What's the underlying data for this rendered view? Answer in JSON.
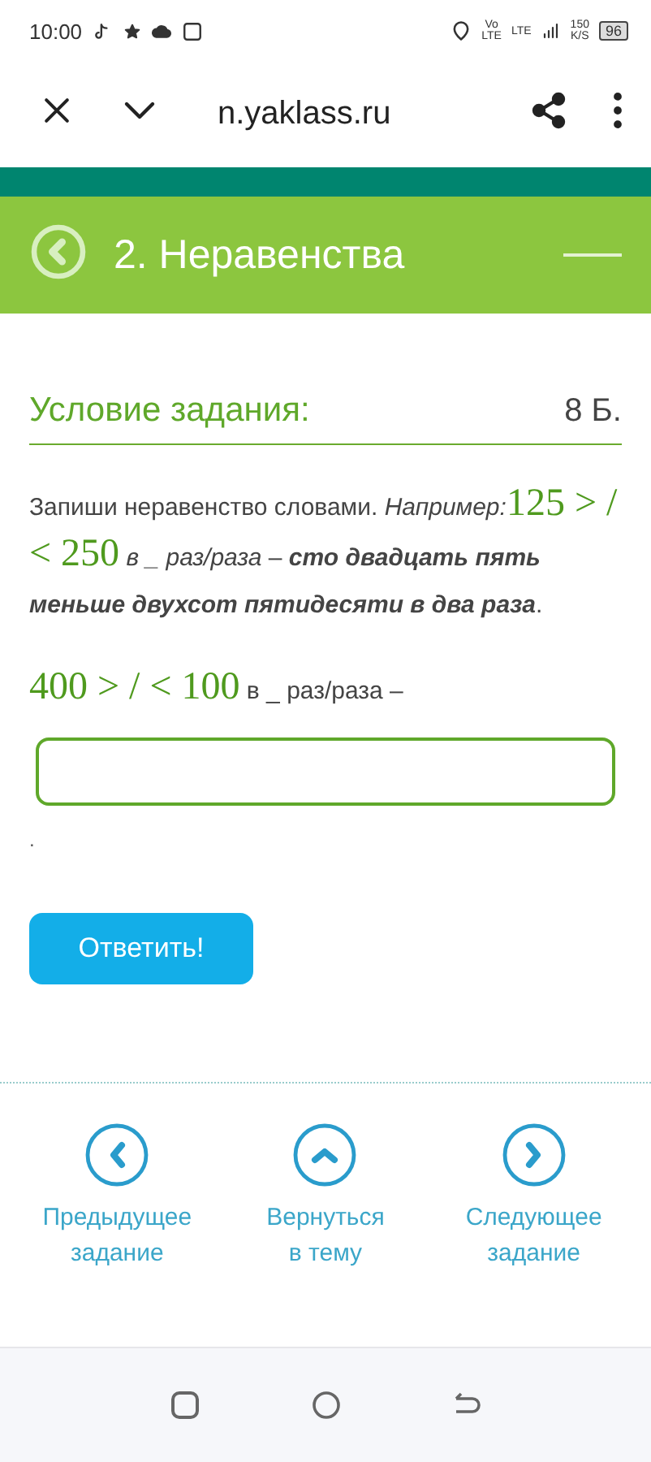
{
  "status_bar": {
    "time": "10:00",
    "volte_top": "Vo",
    "volte_bottom": "LTE",
    "network": "LTE",
    "speed": "150",
    "speed_unit": "K/S",
    "battery": "96"
  },
  "browser": {
    "url": "n.yaklass.ru"
  },
  "header": {
    "title": "2. Неравенства"
  },
  "task": {
    "heading": "Условие задания:",
    "points": "8 Б.",
    "instruction": [
      {
        "kind": "plain",
        "text": "Запиши неравенство словами. "
      },
      {
        "kind": "italic",
        "text": "Например:"
      },
      {
        "kind": "math",
        "text": "125 > / < 250"
      },
      {
        "kind": "italic",
        "text": " в _ раз/раза"
      },
      {
        "kind": "plain",
        "text": " – "
      },
      {
        "kind": "bold_italic",
        "text": "сто двадцать пять меньше двухсот пятидесяти в два раза"
      },
      {
        "kind": "plain",
        "text": "."
      }
    ],
    "question": [
      {
        "kind": "math",
        "text": "400 > / < 100"
      },
      {
        "kind": "plain",
        "text": " в _ раз/раза –"
      }
    ],
    "trailing": ".",
    "submit": "Ответить!"
  },
  "nav": [
    {
      "kind": "prev",
      "lines": [
        "Предыдущее",
        "задание"
      ]
    },
    {
      "kind": "up",
      "lines": [
        "Вернуться",
        "в тему"
      ]
    },
    {
      "kind": "next",
      "lines": [
        "Следующее",
        "задание"
      ]
    }
  ]
}
